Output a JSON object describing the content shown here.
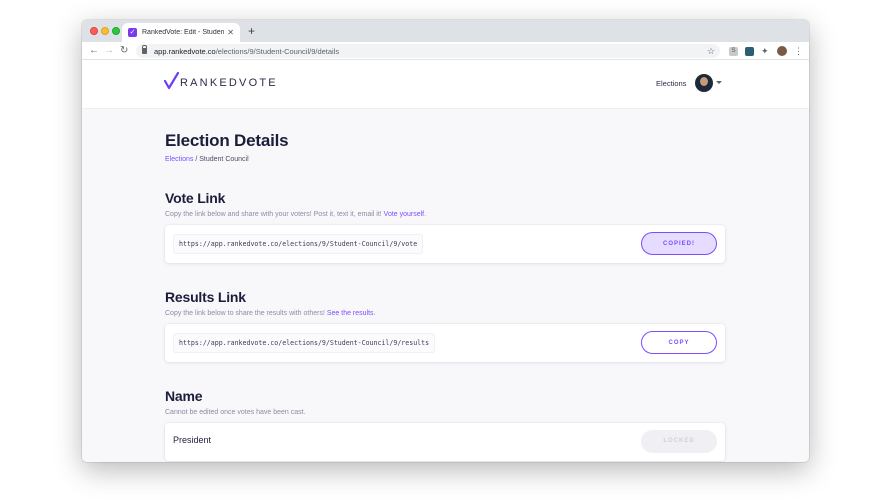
{
  "browser": {
    "tab_title": "RankedVote: Edit - Student Co",
    "url_host": "app.rankedvote.co",
    "url_path": "/elections/9/Student-Council/9/details",
    "extension_label": "S"
  },
  "header": {
    "logo_text": "RANKEDVOTE",
    "nav_elections": "Elections"
  },
  "page": {
    "title": "Election Details",
    "breadcrumb_link": "Elections",
    "breadcrumb_sep": " / ",
    "breadcrumb_current": "Student Council"
  },
  "vote_link": {
    "heading": "Vote Link",
    "description": "Copy the link below and share with your voters! Post it, text it, email it! ",
    "description_link": "Vote yourself",
    "description_end": ".",
    "url": "https://app.rankedvote.co/elections/9/Student-Council/9/vote",
    "button": "COPIED!"
  },
  "results_link": {
    "heading": "Results Link",
    "description": "Copy the link below to share the results with others! ",
    "description_link": "See the results",
    "description_end": ".",
    "url": "https://app.rankedvote.co/elections/9/Student-Council/9/results",
    "button": "COPY"
  },
  "name_section": {
    "heading": "Name",
    "description": "Cannot be edited once votes have been cast.",
    "value": "President",
    "button": "LOCKED"
  },
  "colors": {
    "accent": "#7c4dff",
    "heading": "#1c1d3a",
    "muted": "#8a8ca3"
  }
}
